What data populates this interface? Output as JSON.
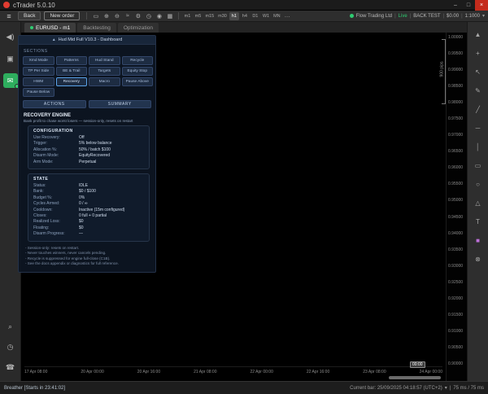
{
  "window": {
    "title": "cTrader 5.0.10",
    "controls": {
      "minimize": "–",
      "maximize": "□",
      "close": "×"
    }
  },
  "toolbar": {
    "menu_glyph": "≡",
    "back_label": "Back",
    "new_order_label": "New order",
    "icons": [
      {
        "name": "chart-type-icon",
        "glyph": "▭"
      },
      {
        "name": "zoom-in-icon",
        "glyph": "⊕"
      },
      {
        "name": "zoom-out-icon",
        "glyph": "⊖"
      },
      {
        "name": "indicators-icon",
        "glyph": "≈"
      },
      {
        "name": "settings-gear-icon",
        "glyph": "⚙"
      },
      {
        "name": "alert-clock-icon",
        "glyph": "◷"
      },
      {
        "name": "view-eye-icon",
        "glyph": "◉"
      },
      {
        "name": "grid-icon",
        "glyph": "▦"
      }
    ],
    "timeframes": [
      "m1",
      "m5",
      "m15",
      "m30",
      "h1",
      "h4",
      "D1",
      "W1",
      "MN"
    ],
    "active_timeframe_index": 4,
    "more_label": "…"
  },
  "account": {
    "broker": "Flow Trading Ltd",
    "separator": "|",
    "mode": "Live",
    "badge": "BACK TEST",
    "balance": "$0.00",
    "leverage": "1:1000",
    "chevron": "▾"
  },
  "tabs": [
    {
      "label": "EURUSD - m1",
      "active": true
    },
    {
      "label": "Backtesting",
      "active": false
    },
    {
      "label": "Optimization",
      "active": false
    }
  ],
  "sidebar": {
    "top_icons": [
      {
        "name": "volume-icon",
        "glyph": "◀)"
      },
      {
        "name": "copy-windows-icon",
        "glyph": "▣"
      },
      {
        "name": "algo-mail-icon",
        "glyph": "✉",
        "active": true
      }
    ],
    "bottom_icons": [
      {
        "name": "search-icon",
        "glyph": "⌕"
      },
      {
        "name": "alerts-icon",
        "glyph": "◷"
      },
      {
        "name": "support-icon",
        "glyph": "☎"
      }
    ]
  },
  "panel": {
    "chevron": "▲",
    "header": "Hud Mid Full V10.3 - Dashboard",
    "sections_label": "SECTIONS",
    "section_rows": [
      [
        "Xmd Mode",
        "Patterns",
        "Hud Stand",
        "Recycle"
      ],
      [
        "TP Per Side",
        "BE & Trail",
        "Targets",
        "Equity Stop"
      ],
      [
        "HWM",
        "Recovery",
        "Macro",
        "Pause Above"
      ],
      [
        "Pause Below"
      ]
    ],
    "active_section": "Recovery",
    "actions_label": "ACTIONS",
    "summary_label": "SUMMARY",
    "engine": {
      "title": "RECOVERY ENGINE",
      "subtitle": "Bank profit to chase worst losers — session-only, resets on restart",
      "configuration": {
        "title": "CONFIGURATION",
        "rows": [
          [
            "Use Recovery:",
            "Off"
          ],
          [
            "Trigger:",
            "5% below balance"
          ],
          [
            "Allocation %:",
            "50% / batch $100"
          ],
          [
            "Disarm Mode:",
            "EquityRecovered"
          ],
          [
            "Arm Mode:",
            "Perpetual"
          ]
        ]
      },
      "state": {
        "title": "STATE",
        "rows": [
          [
            "Status:",
            "IDLE"
          ],
          [
            "Bank:",
            "$0 / $100"
          ],
          [
            "Budget %:",
            "0%"
          ],
          [
            "Cycles Armed:",
            "0 / ∞"
          ],
          [
            "Cooldown:",
            "Inactive (15m configured)"
          ],
          [
            "Closes:",
            "0 full + 0 partial"
          ],
          [
            "Realized Loss:",
            "$0"
          ],
          [
            "Floating:",
            "$0"
          ],
          [
            "Disarm Progress:",
            "—"
          ]
        ]
      },
      "notes": [
        "- Session-only: resets on restart.",
        "- Never touches winners, never cancels pending.",
        "- Recycle is suppressed for engine full-close (C1B).",
        "- See the docs appendix or diagnostics for full reference."
      ]
    }
  },
  "chart": {
    "price_labels": [
      "1.00000",
      "0.99500",
      "0.99000",
      "0.98500",
      "0.98000",
      "0.97500",
      "0.97000",
      "0.96500",
      "0.96000",
      "0.95500",
      "0.95000",
      "0.94500",
      "0.94000",
      "0.93500",
      "0.93000",
      "0.92500",
      "0.92000",
      "0.91500",
      "0.91000",
      "0.90500",
      "0.90000"
    ],
    "time_labels": [
      "17 Apr 08:00",
      "20 Apr 00:00",
      "20 Apr 16:00",
      "21 Apr 08:00",
      "22 Apr 00:00",
      "22 Apr 16:00",
      "23 Apr 08:00",
      "24 Apr 00:00"
    ],
    "pips_annotation": "900 pips",
    "axis_marker": "00:00"
  },
  "right_toolbar": {
    "icons": [
      {
        "name": "collapse-toolbar-icon",
        "glyph": "▲"
      },
      {
        "name": "crosshair-icon",
        "glyph": "+"
      },
      {
        "name": "cursor-icon",
        "glyph": "↖"
      },
      {
        "name": "pencil-draw-icon",
        "glyph": "✎"
      },
      {
        "name": "trendline-icon",
        "glyph": "╱"
      },
      {
        "name": "horizontal-line-icon",
        "glyph": "─"
      },
      {
        "name": "vertical-line-icon",
        "glyph": "│"
      },
      {
        "name": "rectangle-tool-icon",
        "glyph": "▭"
      },
      {
        "name": "ellipse-tool-icon",
        "glyph": "○"
      },
      {
        "name": "triangle-tool-icon",
        "glyph": "△"
      },
      {
        "name": "text-tool-icon",
        "glyph": "T"
      },
      {
        "name": "color-swatch",
        "glyph": "■",
        "color": "#bd6fd8"
      },
      {
        "name": "delete-drawings-icon",
        "glyph": "⊗"
      }
    ]
  },
  "statusbar": {
    "left": "Breather [Starts in 23:41:02]",
    "current_bar": "Current bar: 25/09/2025 04:18:57 (UTC+2)",
    "chevron": "▾",
    "separator": "|",
    "latency": "75 ms / 75 ms"
  }
}
